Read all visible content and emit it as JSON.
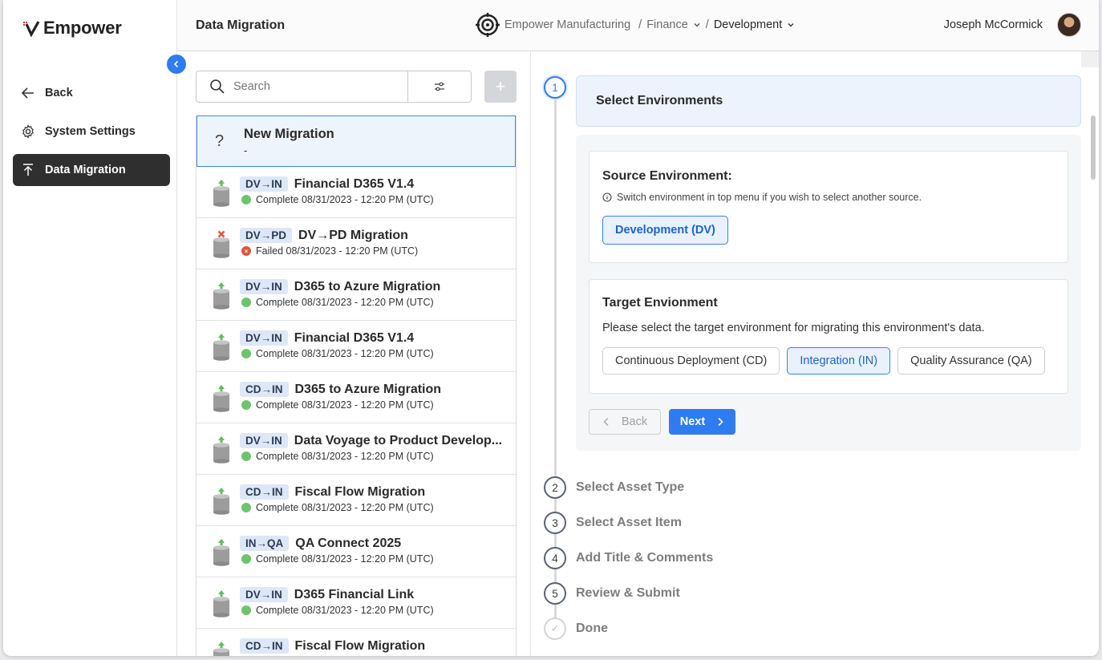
{
  "brand": {
    "name": "Empower"
  },
  "sidebar": {
    "items": [
      {
        "label": "Back",
        "icon": "arrow-left-icon"
      },
      {
        "label": "System Settings",
        "icon": "gear-icon"
      },
      {
        "label": "Data Migration",
        "icon": "upload-icon",
        "active": true
      }
    ]
  },
  "header": {
    "title": "Data Migration",
    "breadcrumb": {
      "org": "Empower Manufacturing",
      "sep1": "/",
      "dept": "Finance",
      "sep2": "/",
      "env": "Development"
    },
    "user": {
      "name": "Joseph McCormick"
    }
  },
  "list": {
    "search_placeholder": "Search",
    "add_label": "+",
    "new_item": {
      "icon": "?",
      "title": "New Migration",
      "subtitle": "-"
    },
    "items": [
      {
        "tag": "DV→IN",
        "name": "Financial D365 V1.4",
        "status": "Complete 08/31/2023 - 12:20 PM (UTC)",
        "state": "ok"
      },
      {
        "tag": "DV→PD",
        "name": "DV→PD Migration",
        "status": "Failed 08/31/2023 - 12:20 PM (UTC)",
        "state": "fail"
      },
      {
        "tag": "DV→IN",
        "name": "D365 to Azure Migration",
        "status": "Complete 08/31/2023 - 12:20 PM (UTC)",
        "state": "ok"
      },
      {
        "tag": "DV→IN",
        "name": "Financial D365 V1.4",
        "status": "Complete 08/31/2023 - 12:20 PM (UTC)",
        "state": "ok"
      },
      {
        "tag": "CD→IN",
        "name": "D365 to Azure Migration",
        "status": "Complete 08/31/2023 - 12:20 PM (UTC)",
        "state": "ok"
      },
      {
        "tag": "DV→IN",
        "name": "Data Voyage to Product Develop...",
        "status": "Complete 08/31/2023 - 12:20 PM (UTC)",
        "state": "ok"
      },
      {
        "tag": "CD→IN",
        "name": "Fiscal Flow Migration",
        "status": "Complete 08/31/2023 - 12:20 PM (UTC)",
        "state": "ok"
      },
      {
        "tag": "IN→QA",
        "name": "QA Connect 2025",
        "status": "Complete 08/31/2023 - 12:20 PM (UTC)",
        "state": "ok"
      },
      {
        "tag": "DV→IN",
        "name": "D365 Financial Link",
        "status": "Complete 08/31/2023 - 12:20 PM (UTC)",
        "state": "ok"
      },
      {
        "tag": "CD→IN",
        "name": "Fiscal Flow Migration",
        "status": "",
        "state": "ok"
      }
    ]
  },
  "wizard": {
    "steps": [
      {
        "num": "1",
        "label": "Select Environments"
      },
      {
        "num": "2",
        "label": "Select Asset Type"
      },
      {
        "num": "3",
        "label": "Select Asset Item"
      },
      {
        "num": "4",
        "label": "Add Title & Comments"
      },
      {
        "num": "5",
        "label": "Review & Submit"
      },
      {
        "num": "✓",
        "label": "Done"
      }
    ],
    "source": {
      "title": "Source Environment:",
      "hint": "Switch environment in top menu if you wish to select another source.",
      "selected": "Development (DV)"
    },
    "target": {
      "title": "Target Envionment",
      "desc": "Please select the target environment for migrating this environment's data.",
      "options": [
        "Continuous Deployment (CD)",
        "Integration (IN)",
        "Quality Assurance (QA)"
      ],
      "selected_index": 1
    },
    "back_label": "Back",
    "next_label": "Next"
  },
  "colors": {
    "accent": "#2f7bf0",
    "ok": "#6cc56c",
    "fail": "#e3533c",
    "active_nav": "#2f2f2f"
  }
}
